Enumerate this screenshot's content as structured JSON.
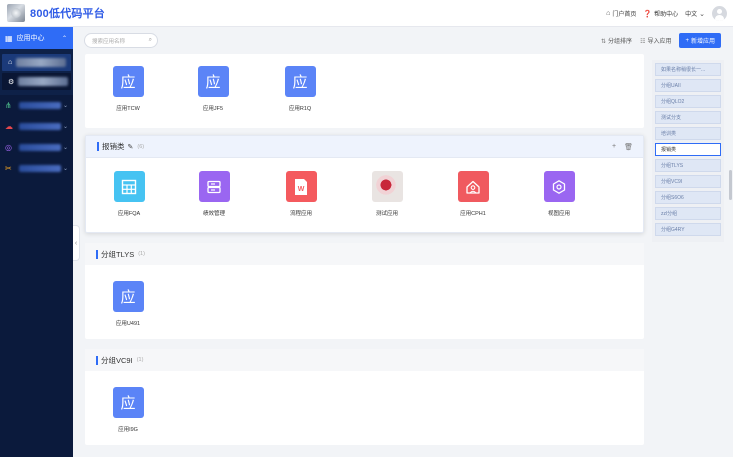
{
  "app": {
    "title": "800低代码平台"
  },
  "topnav": {
    "portal": "门户首页",
    "help": "帮助中心",
    "lang": "中文"
  },
  "sidebar": {
    "head": "应用中心"
  },
  "toolbar": {
    "search_placeholder": "搜索应用名称",
    "sort": "分组排序",
    "import": "导入应用",
    "new_app": "新增应用"
  },
  "tile_char": "应",
  "panels": [
    {
      "title": "",
      "count": "",
      "apps": [
        {
          "label": "应用TCW"
        },
        {
          "label": "应用JF5"
        },
        {
          "label": "应用R1Q"
        }
      ]
    },
    {
      "title": "报销类",
      "count": "(6)",
      "apps": [
        {
          "label": "应用FQA"
        },
        {
          "label": "绩效管理"
        },
        {
          "label": "流程应用"
        },
        {
          "label": "测试应用"
        },
        {
          "label": "应用CPH1"
        },
        {
          "label": "视图应用"
        }
      ]
    },
    {
      "title": "分组TLYS",
      "count": "(1)",
      "apps": [
        {
          "label": "应用U491"
        }
      ]
    },
    {
      "title": "分组VC9I",
      "count": "(1)",
      "apps": [
        {
          "label": "应用I9G"
        }
      ]
    }
  ],
  "groups": [
    "如果名称稍很长一...",
    "分组UAII",
    "分组QLO2",
    "测试分支",
    "培训类",
    "报销类",
    "分组TLYS",
    "分组VC9I",
    "分组S6O6",
    "zzl分组",
    "分组G4RY"
  ],
  "colors": {
    "accent": "#2f6cf6",
    "sidebar": "#0b1a3c"
  }
}
